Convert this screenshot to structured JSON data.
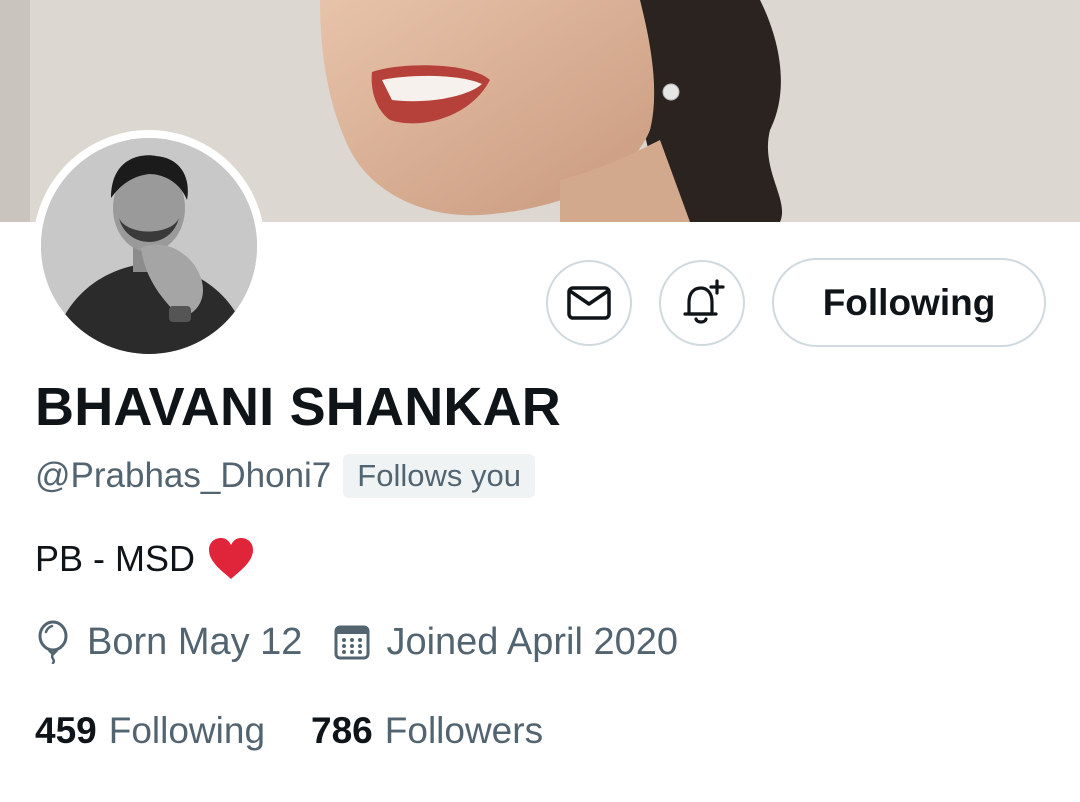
{
  "profile": {
    "display_name": "BHAVANI SHANKAR",
    "handle": "@Prabhas_Dhoni7",
    "follows_you_badge": "Follows you",
    "bio": "PB - MSD",
    "birthday": "Born May 12",
    "joined": "Joined April 2020",
    "following_count": "459",
    "following_label": "Following",
    "followers_count": "786",
    "followers_label": "Followers"
  },
  "actions": {
    "follow_button_label": "Following",
    "message_icon": "envelope-icon",
    "notify_icon": "bell-plus-icon"
  },
  "icons": {
    "birthday": "balloon-icon",
    "joined": "calendar-icon",
    "bio_emoji": "red-heart-icon"
  },
  "colors": {
    "primary_text": "#0f1419",
    "secondary_text": "#536471",
    "button_border": "#cfd9de",
    "badge_bg": "#eff3f4",
    "heart": "#e0243a"
  }
}
